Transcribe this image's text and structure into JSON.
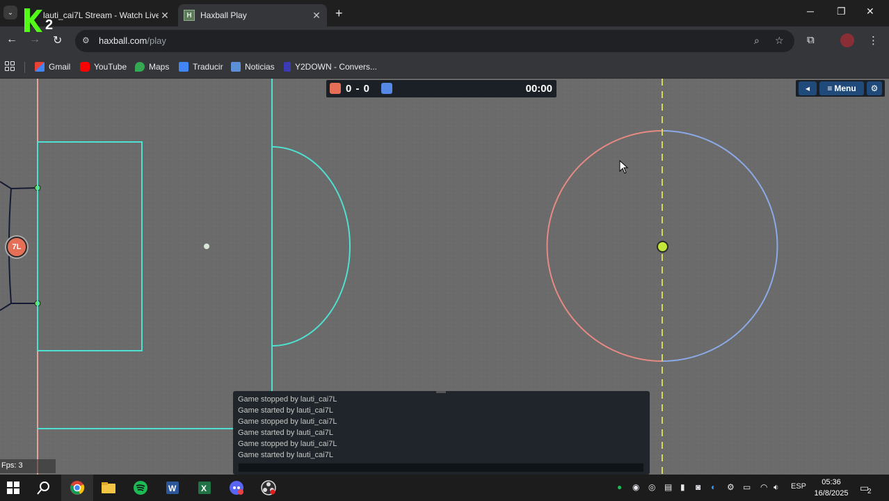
{
  "browser": {
    "tabs": [
      {
        "title": "lauti_cai7L Stream - Watch Live",
        "active": false,
        "favicon": "kick-logo",
        "overlay_badge": "2"
      },
      {
        "title": "Haxball Play",
        "active": true,
        "favicon": "haxball-icon",
        "favicon_letter": "H"
      }
    ],
    "url_host": "haxball.com",
    "url_path": "/play",
    "bookmarks": [
      {
        "label": "Gmail",
        "icon": "gmail-icon"
      },
      {
        "label": "YouTube",
        "icon": "youtube-icon"
      },
      {
        "label": "Maps",
        "icon": "maps-icon"
      },
      {
        "label": "Traducir",
        "icon": "translate-icon"
      },
      {
        "label": "Noticias",
        "icon": "news-icon"
      },
      {
        "label": "Y2DOWN - Convers...",
        "icon": "y2down-icon"
      }
    ]
  },
  "game": {
    "score": "0 - 0",
    "timer": "00:00",
    "menu_label": "Menu",
    "team_red_color": "#e56e56",
    "team_blue_color": "#5689e5",
    "player_label": "7L",
    "fps_label": "Fps: 3",
    "chat": [
      "Game stopped by lauti_cai7L",
      "Game started by lauti_cai7L",
      "Game stopped by lauti_cai7L",
      "Game started by lauti_cai7L",
      "Game stopped by lauti_cai7L",
      "Game started by lauti_cai7L"
    ]
  },
  "taskbar": {
    "language": "ESP",
    "time": "05:36",
    "date": "16/8/2025",
    "notification_count": "2"
  }
}
